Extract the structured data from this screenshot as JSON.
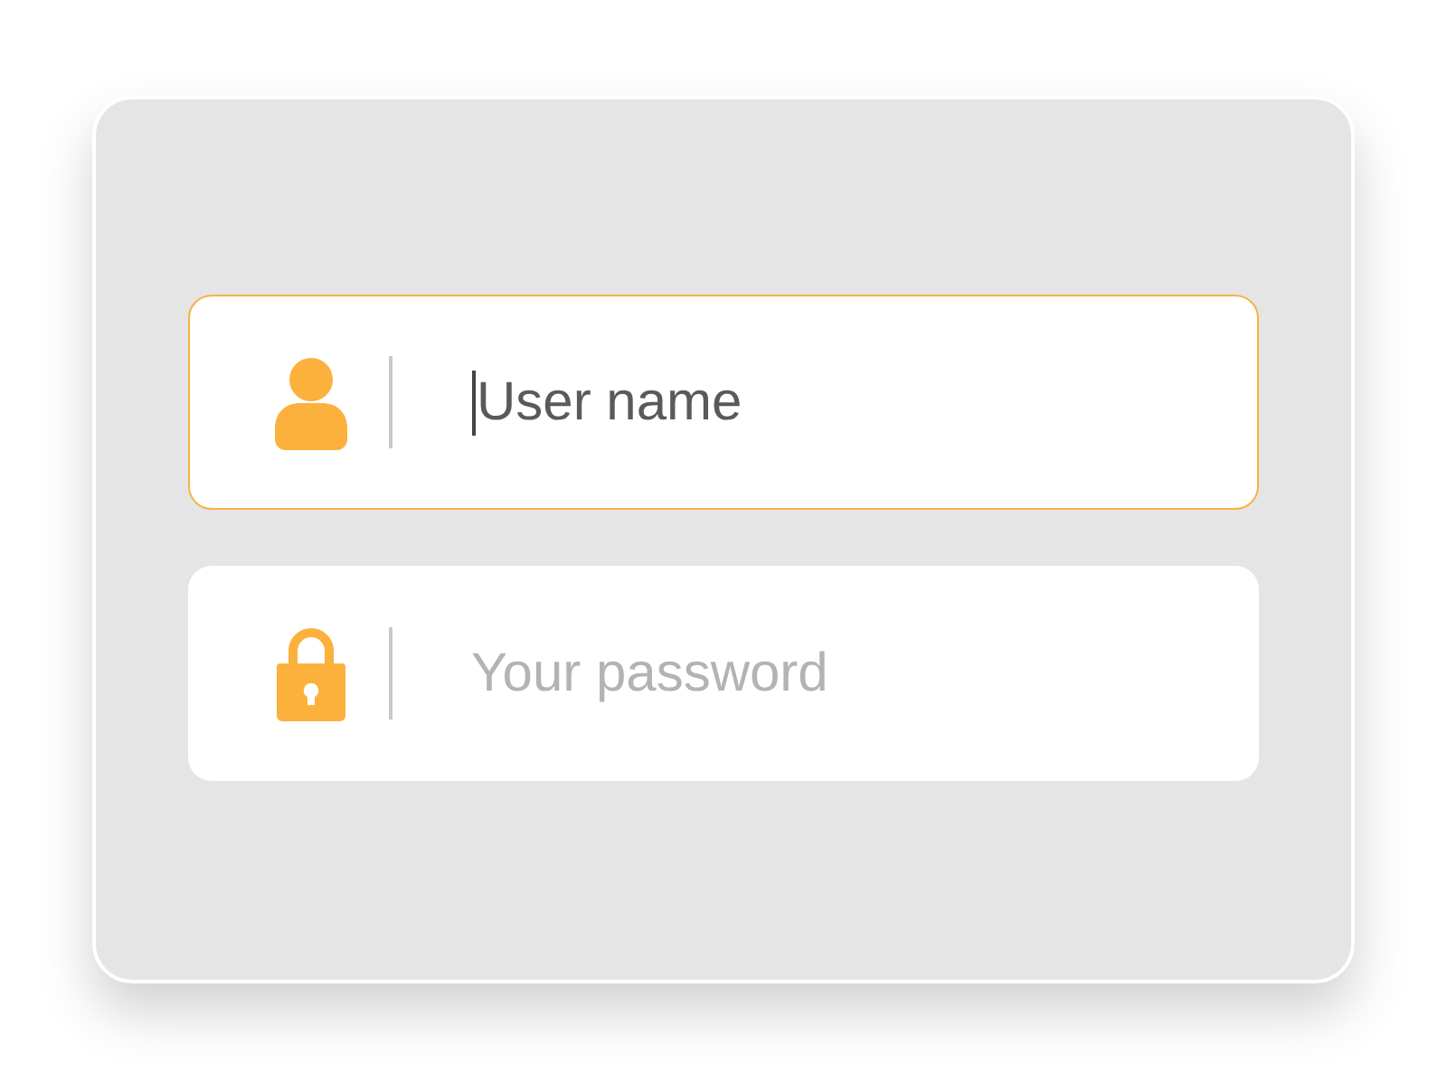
{
  "fields": [
    {
      "placeholder": "User name",
      "focused": true
    },
    {
      "placeholder": "Your password",
      "focused": false
    }
  ]
}
